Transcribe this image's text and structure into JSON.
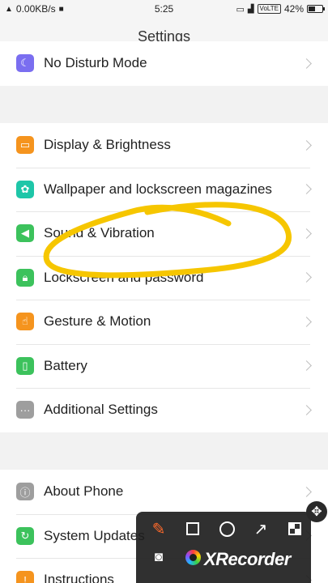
{
  "status_bar": {
    "speed": "0.00KB/s",
    "time": "5:25",
    "volte": "VoLTE",
    "battery": "42%"
  },
  "header": {
    "title": "Settings"
  },
  "groups": [
    {
      "items": [
        {
          "label": "No Disturb Mode",
          "icon": "moon-icon",
          "color": "#7a6ef0"
        }
      ]
    },
    {
      "items": [
        {
          "label": "Display & Brightness",
          "icon": "display-icon",
          "color": "#f5941e"
        },
        {
          "label": "Wallpaper and lockscreen magazines",
          "icon": "flower-icon",
          "color": "#1ec6a8"
        },
        {
          "label": "Sound & Vibration",
          "icon": "speaker-icon",
          "color": "#3cc25c"
        },
        {
          "label": "Lockscreen and password",
          "icon": "lock-icon",
          "color": "#3cc25c"
        },
        {
          "label": "Gesture & Motion",
          "icon": "hand-icon",
          "color": "#f5941e"
        },
        {
          "label": "Battery",
          "icon": "battery-icon",
          "color": "#3cc25c"
        },
        {
          "label": "Additional Settings",
          "icon": "more-icon",
          "color": "#9e9e9e"
        }
      ]
    },
    {
      "items": [
        {
          "label": "About Phone",
          "icon": "info-icon",
          "color": "#9e9e9e"
        },
        {
          "label": "System Updates",
          "icon": "update-icon",
          "color": "#3cc25c"
        },
        {
          "label": "Instructions",
          "icon": "instructions-icon",
          "color": "#f5941e"
        }
      ]
    }
  ],
  "annotation": {
    "color": "#f6c600"
  },
  "recorder": {
    "brand": "XRecorder"
  }
}
